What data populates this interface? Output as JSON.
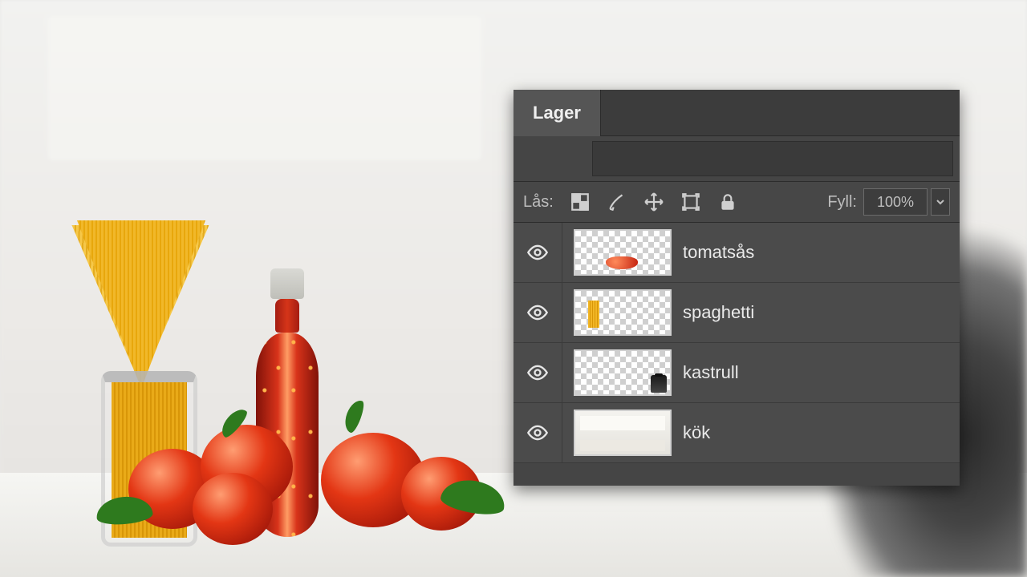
{
  "panel": {
    "tab_label": "Lager",
    "lock_label": "Lås:",
    "fill_label": "Fyll:",
    "fill_value": "100%"
  },
  "layers": [
    {
      "name": "tomatsås"
    },
    {
      "name": "spaghetti"
    },
    {
      "name": "kastrull"
    },
    {
      "name": "kök"
    }
  ]
}
